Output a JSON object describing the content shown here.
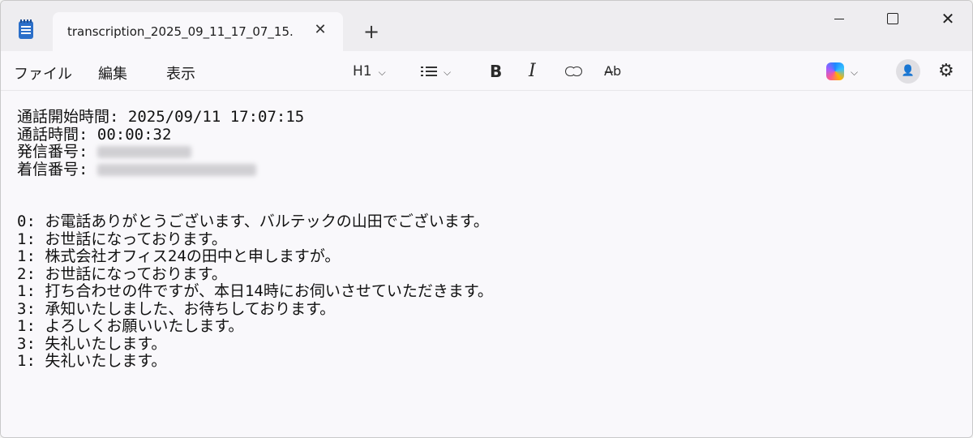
{
  "tab": {
    "title": "transcription_2025_09_11_17_07_15.",
    "close_glyph": "✕",
    "new_tab_glyph": "+"
  },
  "window_controls": {
    "close_glyph": "✕"
  },
  "menu": {
    "file": "ファイル",
    "edit": "編集",
    "view": "表示"
  },
  "toolbar": {
    "heading_label": "H1",
    "bold_label": "B",
    "italic_label": "I",
    "spell_label": "A̶b",
    "chevron": "⌵",
    "settings_glyph": "⚙",
    "avatar_glyph": "👤"
  },
  "document": {
    "header": [
      {
        "label": "通話開始時間: ",
        "value": "2025/09/11 17:07:15"
      },
      {
        "label": "通話時間: ",
        "value": "00:00:32"
      },
      {
        "label": "発信番号: ",
        "value": ""
      },
      {
        "label": "着信番号: ",
        "value": ""
      }
    ],
    "lines": [
      "0: お電話ありがとうございます、バルテックの山田でございます。",
      "1: お世話になっております。",
      "1: 株式会社オフィス24の田中と申しますが。",
      "2: お世話になっております。",
      "1: 打ち合わせの件ですが、本日14時にお伺いさせていただきます。",
      "3: 承知いたしました、お待ちしております。",
      "1: よろしくお願いいたします。",
      "3: 失礼いたします。",
      "1: 失礼いたします。"
    ]
  },
  "colors": {
    "window_bg": "#f9f8fb",
    "titlebar_bg": "#eeedf0",
    "text": "#111111"
  }
}
